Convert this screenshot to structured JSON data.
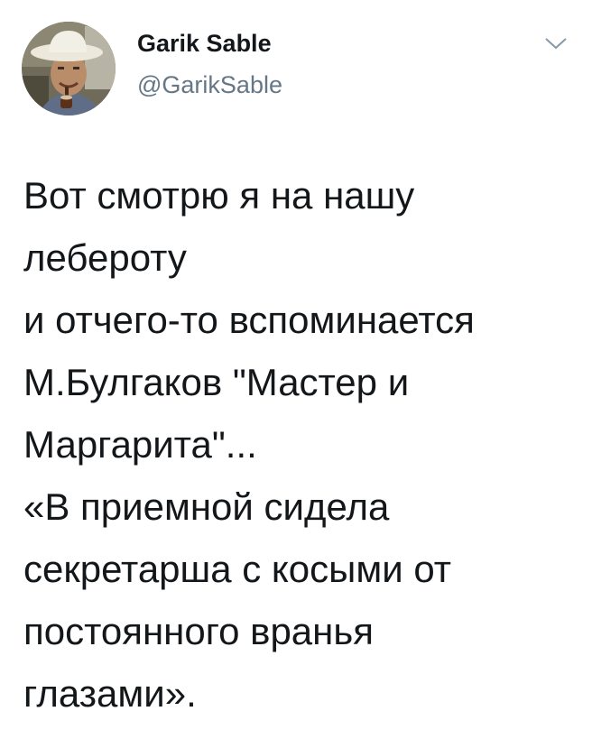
{
  "author": {
    "display_name": "Garik Sable",
    "handle": "@GarikSable",
    "avatar_icon": "user-avatar-photo"
  },
  "menu": {
    "icon": "chevron-down-icon"
  },
  "tweet": {
    "lines": [
      "Вот смотрю я на нашу",
      "лебероту",
      "и отчего-то вспоминается",
      "М.Булгаков \"Мастер и",
      "Маргарита\"...",
      "«В приемной сидела",
      "секретарша с косыми от",
      "постоянного вранья",
      "глазами»."
    ]
  },
  "colors": {
    "text": "#14171a",
    "secondary_text": "#657786",
    "background": "#ffffff"
  }
}
